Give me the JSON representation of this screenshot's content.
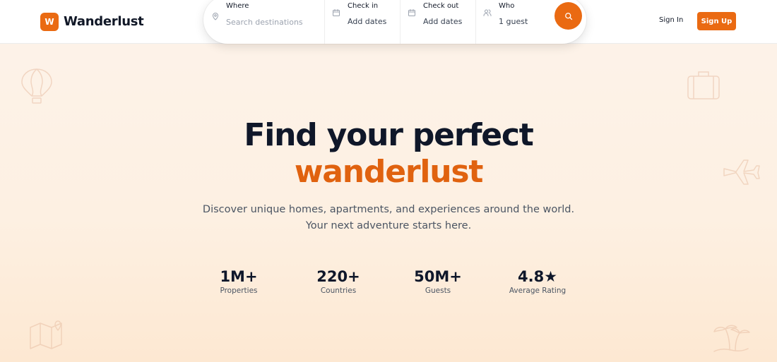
{
  "brand": {
    "mark": "W",
    "name": "Wanderlust"
  },
  "search": {
    "where": {
      "label": "Where",
      "placeholder": "Search destinations"
    },
    "check_in": {
      "label": "Check in",
      "value": "Add dates"
    },
    "check_out": {
      "label": "Check out",
      "value": "Add dates"
    },
    "who": {
      "label": "Who",
      "value": "1 guest"
    }
  },
  "auth": {
    "sign_in": "Sign In",
    "sign_up": "Sign Up"
  },
  "hero": {
    "title_line1": "Find your perfect",
    "title_line2": "wanderlust",
    "subtitle_line1": "Discover unique homes, apartments, and experiences around the world.",
    "subtitle_line2": "Your next adventure starts here."
  },
  "stats": [
    {
      "value": "1M+",
      "label": "Properties"
    },
    {
      "value": "220+",
      "label": "Countries"
    },
    {
      "value": "50M+",
      "label": "Guests"
    },
    {
      "value": "4.8★",
      "label": "Average Rating"
    }
  ],
  "colors": {
    "accent": "#ea6a12",
    "title": "#0f1729",
    "background": "#fdf3ea"
  }
}
